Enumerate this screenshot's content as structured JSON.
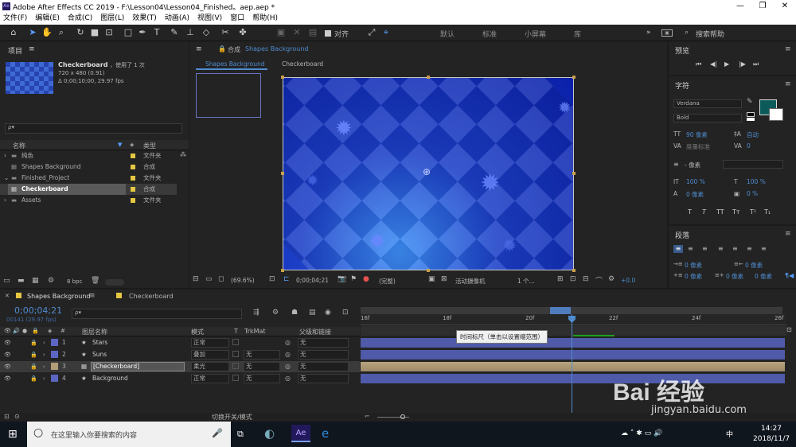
{
  "window": {
    "title": "Adobe After Effects CC 2019 - F:\\Lesson04\\Lesson04_Finished。aep.aep *",
    "logo": "Ae",
    "minimize": "—",
    "restore": "❐",
    "close": "✕"
  },
  "menu": [
    "文件(F)",
    "编辑(E)",
    "合成(C)",
    "图层(L)",
    "效果(T)",
    "动画(A)",
    "视图(V)",
    "窗口",
    "帮助(H)"
  ],
  "toolbar": {
    "align_label": "对齐",
    "workspaces": [
      "默认",
      "标准",
      "小屏幕",
      "库"
    ],
    "more": "»",
    "search_placeholder": "搜索帮助"
  },
  "project": {
    "title": "项目",
    "menu": "≡",
    "item_name": "Checkerboard",
    "item_used": "，使用了 1 次",
    "item_size": "720 x 480 (0.91)",
    "item_duration": "Δ 0;00;10;00, 29.97 fps",
    "search_placeholder": "ρ▾",
    "col_name": "名称",
    "col_type": "类型",
    "items": [
      {
        "name": "纯色",
        "type": "文件夹",
        "kind": "folder"
      },
      {
        "name": "Shapes Background",
        "type": "合成",
        "kind": "comp"
      },
      {
        "name": "Finished_Project",
        "type": "文件夹",
        "kind": "folder"
      },
      {
        "name": "Checkerboard",
        "type": "合成",
        "kind": "comp"
      },
      {
        "name": "Assets",
        "type": "文件夹",
        "kind": "folder"
      }
    ],
    "bpc": "8 bpc"
  },
  "comp": {
    "title_prefix": "合成",
    "title_name": "Shapes Background",
    "tabs": [
      "Shapes Background",
      "Checkerboard"
    ],
    "zoom": "(69.6%)",
    "timecode": "0;00;04;21",
    "quality": "(完整)",
    "camera": "活动摄像机",
    "views": "1 个...",
    "exposure": "+0.0"
  },
  "preview": {
    "title": "预览",
    "buttons": [
      "⏮",
      "◀|",
      "▶",
      "|▶",
      "⏭"
    ]
  },
  "character": {
    "title": "字符",
    "font": "Verdana",
    "style": "Bold",
    "size": "90 像素",
    "leading": "自动",
    "kerning": "度量标准",
    "tracking": "0",
    "stroke": "- 像素",
    "vscale": "100 %",
    "hscale": "100 %",
    "baseline": "0 像素",
    "tsume": "0 %",
    "styles": [
      "T",
      "T",
      "TT",
      "Tт",
      "T¹",
      "T₁"
    ]
  },
  "paragraph": {
    "title": "段落",
    "indent_left": "0 像素",
    "indent_right": "0 像素",
    "indent_first": "0 像素",
    "space_before": "0 像素",
    "space_after": "0 像素"
  },
  "timeline": {
    "tabs": [
      "Shapes Background",
      "Checkerboard"
    ],
    "timecode": "0;00;04;21",
    "timecode_sub": "00141 (29.97 fps)",
    "search_placeholder": "ρ▾",
    "col_name": "图层名称",
    "col_mode": "模式",
    "col_t": "T",
    "col_trkmat": "TrkMat",
    "col_parent": "父级和链接",
    "layers": [
      {
        "num": "1",
        "name": "Stars",
        "mode": "正常",
        "trkmat": "",
        "parent": "无",
        "icon": "★",
        "color": "#5c67c4",
        "selected": false
      },
      {
        "num": "2",
        "name": "Suns",
        "mode": "叠加",
        "trkmat": "无",
        "parent": "无",
        "icon": "★",
        "color": "#5c67c4",
        "selected": false
      },
      {
        "num": "3",
        "name": "[Checkerboard]",
        "mode": "柔光",
        "trkmat": "无",
        "parent": "无",
        "icon": "▦",
        "color": "#b29d79",
        "selected": true
      },
      {
        "num": "4",
        "name": "Background",
        "mode": "正常",
        "trkmat": "无",
        "parent": "无",
        "icon": "★",
        "color": "#5c67c4",
        "selected": false
      }
    ],
    "ruler": [
      "16f",
      "18f",
      "20f",
      "22f",
      "24f",
      "26f"
    ],
    "tooltip": "时间标尺（单击以设置缩范围）",
    "footer_toggle": "切换开关/模式"
  },
  "taskbar": {
    "search": "在这里输入你要搜索的内容",
    "time": "14:27",
    "date": "2018/11/7",
    "lang": "中"
  },
  "watermark": {
    "brand": "Bai 经验",
    "url": "jingyan.baidu.com"
  }
}
